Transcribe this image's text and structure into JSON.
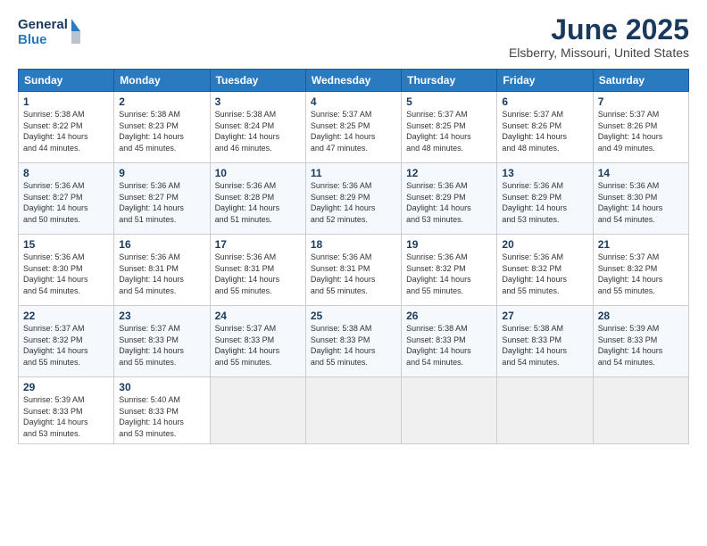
{
  "header": {
    "logo_general": "General",
    "logo_blue": "Blue",
    "month": "June 2025",
    "location": "Elsberry, Missouri, United States"
  },
  "days_of_week": [
    "Sunday",
    "Monday",
    "Tuesday",
    "Wednesday",
    "Thursday",
    "Friday",
    "Saturday"
  ],
  "weeks": [
    [
      {
        "day": 1,
        "sunrise": "5:38 AM",
        "sunset": "8:22 PM",
        "daylight": "14 hours and 44 minutes."
      },
      {
        "day": 2,
        "sunrise": "5:38 AM",
        "sunset": "8:23 PM",
        "daylight": "14 hours and 45 minutes."
      },
      {
        "day": 3,
        "sunrise": "5:38 AM",
        "sunset": "8:24 PM",
        "daylight": "14 hours and 46 minutes."
      },
      {
        "day": 4,
        "sunrise": "5:37 AM",
        "sunset": "8:25 PM",
        "daylight": "14 hours and 47 minutes."
      },
      {
        "day": 5,
        "sunrise": "5:37 AM",
        "sunset": "8:25 PM",
        "daylight": "14 hours and 48 minutes."
      },
      {
        "day": 6,
        "sunrise": "5:37 AM",
        "sunset": "8:26 PM",
        "daylight": "14 hours and 48 minutes."
      },
      {
        "day": 7,
        "sunrise": "5:37 AM",
        "sunset": "8:26 PM",
        "daylight": "14 hours and 49 minutes."
      }
    ],
    [
      {
        "day": 8,
        "sunrise": "5:36 AM",
        "sunset": "8:27 PM",
        "daylight": "14 hours and 50 minutes."
      },
      {
        "day": 9,
        "sunrise": "5:36 AM",
        "sunset": "8:27 PM",
        "daylight": "14 hours and 51 minutes."
      },
      {
        "day": 10,
        "sunrise": "5:36 AM",
        "sunset": "8:28 PM",
        "daylight": "14 hours and 51 minutes."
      },
      {
        "day": 11,
        "sunrise": "5:36 AM",
        "sunset": "8:29 PM",
        "daylight": "14 hours and 52 minutes."
      },
      {
        "day": 12,
        "sunrise": "5:36 AM",
        "sunset": "8:29 PM",
        "daylight": "14 hours and 53 minutes."
      },
      {
        "day": 13,
        "sunrise": "5:36 AM",
        "sunset": "8:29 PM",
        "daylight": "14 hours and 53 minutes."
      },
      {
        "day": 14,
        "sunrise": "5:36 AM",
        "sunset": "8:30 PM",
        "daylight": "14 hours and 54 minutes."
      }
    ],
    [
      {
        "day": 15,
        "sunrise": "5:36 AM",
        "sunset": "8:30 PM",
        "daylight": "14 hours and 54 minutes."
      },
      {
        "day": 16,
        "sunrise": "5:36 AM",
        "sunset": "8:31 PM",
        "daylight": "14 hours and 54 minutes."
      },
      {
        "day": 17,
        "sunrise": "5:36 AM",
        "sunset": "8:31 PM",
        "daylight": "14 hours and 55 minutes."
      },
      {
        "day": 18,
        "sunrise": "5:36 AM",
        "sunset": "8:31 PM",
        "daylight": "14 hours and 55 minutes."
      },
      {
        "day": 19,
        "sunrise": "5:36 AM",
        "sunset": "8:32 PM",
        "daylight": "14 hours and 55 minutes."
      },
      {
        "day": 20,
        "sunrise": "5:36 AM",
        "sunset": "8:32 PM",
        "daylight": "14 hours and 55 minutes."
      },
      {
        "day": 21,
        "sunrise": "5:37 AM",
        "sunset": "8:32 PM",
        "daylight": "14 hours and 55 minutes."
      }
    ],
    [
      {
        "day": 22,
        "sunrise": "5:37 AM",
        "sunset": "8:32 PM",
        "daylight": "14 hours and 55 minutes."
      },
      {
        "day": 23,
        "sunrise": "5:37 AM",
        "sunset": "8:33 PM",
        "daylight": "14 hours and 55 minutes."
      },
      {
        "day": 24,
        "sunrise": "5:37 AM",
        "sunset": "8:33 PM",
        "daylight": "14 hours and 55 minutes."
      },
      {
        "day": 25,
        "sunrise": "5:38 AM",
        "sunset": "8:33 PM",
        "daylight": "14 hours and 55 minutes."
      },
      {
        "day": 26,
        "sunrise": "5:38 AM",
        "sunset": "8:33 PM",
        "daylight": "14 hours and 54 minutes."
      },
      {
        "day": 27,
        "sunrise": "5:38 AM",
        "sunset": "8:33 PM",
        "daylight": "14 hours and 54 minutes."
      },
      {
        "day": 28,
        "sunrise": "5:39 AM",
        "sunset": "8:33 PM",
        "daylight": "14 hours and 54 minutes."
      }
    ],
    [
      {
        "day": 29,
        "sunrise": "5:39 AM",
        "sunset": "8:33 PM",
        "daylight": "14 hours and 53 minutes."
      },
      {
        "day": 30,
        "sunrise": "5:40 AM",
        "sunset": "8:33 PM",
        "daylight": "14 hours and 53 minutes."
      },
      null,
      null,
      null,
      null,
      null
    ]
  ]
}
